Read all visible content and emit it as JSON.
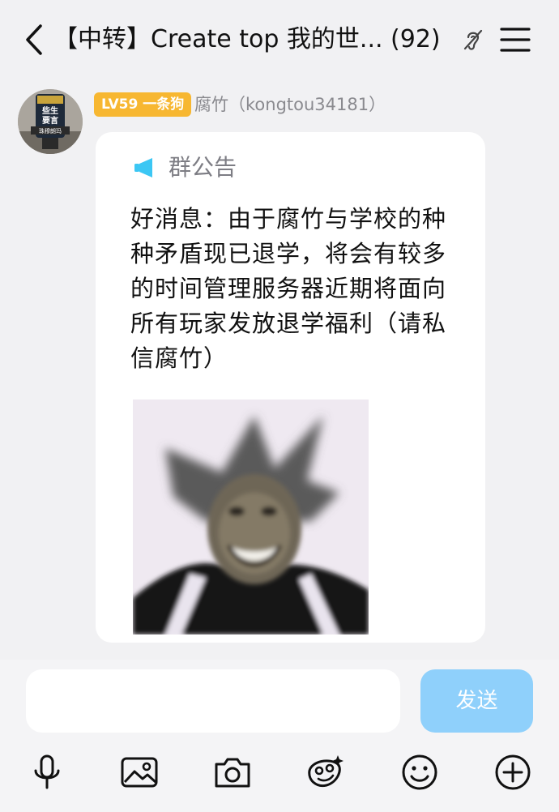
{
  "header": {
    "title": "【中转】Create top 我的世... (92)"
  },
  "message": {
    "level_badge": "LV59 一条狗",
    "sender": "腐竹（kongtou34181）",
    "notice": {
      "title": "群公告",
      "text": "好消息：由于腐竹与学校的种种矛盾现已退学，将会有较多的时间管理服务器近期将面向所有玩家发放退学福利（请私信腐竹）"
    },
    "avatar_text": {
      "top": "些生",
      "mid": "要言",
      "bottom": "珠穆朗玛"
    }
  },
  "input": {
    "placeholder": "",
    "value": "",
    "send_label": "发送"
  },
  "toolbar": {
    "icons": [
      "microphone-icon",
      "image-icon",
      "camera-icon",
      "sticker-icon",
      "emoji-icon",
      "plus-icon"
    ]
  },
  "colors": {
    "badge": "#f7b731",
    "send_button": "#8fd0fb",
    "megaphone": "#3cc7f4",
    "background": "#f1f1f3"
  }
}
